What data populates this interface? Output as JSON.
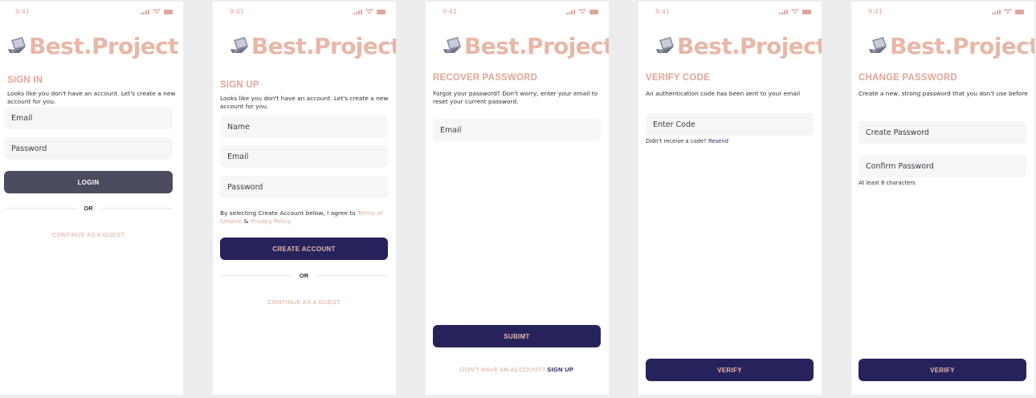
{
  "status": {
    "time": "9:41"
  },
  "brand": {
    "name": "Best.Project",
    "accent": "#e8b7a7",
    "navy": "#26235c"
  },
  "signin": {
    "title": "SIGN IN",
    "subtitle": "Looks like you don't have an account. Let's create a new account for you.",
    "email_placeholder": "Email",
    "password_placeholder": "Password",
    "login_label": "LOGIN",
    "or_label": "OR",
    "guest_label": "CONTINUE AS A GUEST"
  },
  "signup": {
    "title": "SIGN UP",
    "subtitle": "Looks like you don't have an account. Let's create a new account for you.",
    "name_placeholder": "Name",
    "email_placeholder": "Email",
    "password_placeholder": "Password",
    "terms_prefix": "By selecting Create Account below, I agree to ",
    "terms_link": "Terms of Service",
    "terms_amp": " & ",
    "privacy_link": "Privacy Policy",
    "create_label": "CREATE ACCOUNT",
    "or_label": "OR",
    "guest_label": "CONTINUE AS A GUEST"
  },
  "recover": {
    "title": "RECOVER PASSWORD",
    "subtitle": "Forgot your password? Don't worry, enter your email to reset your current password.",
    "email_placeholder": "Email",
    "submit_label": "SUBIMT",
    "no_account_label": "DON'T HAVE AN ACCOUNT?",
    "signup_link": "SIGN UP"
  },
  "verify": {
    "title": "VERIFY CODE",
    "subtitle": "An authentication code has been sent to your email",
    "code_placeholder": "Enter Code",
    "no_code_label": "Didn't receive a code?",
    "resend_link": "Resend",
    "verify_label": "VERIFY"
  },
  "change": {
    "title": "CHANGE PASSWORD",
    "subtitle": "Create a new, strong password that you don't use before",
    "create_placeholder": "Create Password",
    "confirm_placeholder": "Confirm Password",
    "hint": "At least 8 characters",
    "verify_label": "VERIFY"
  }
}
